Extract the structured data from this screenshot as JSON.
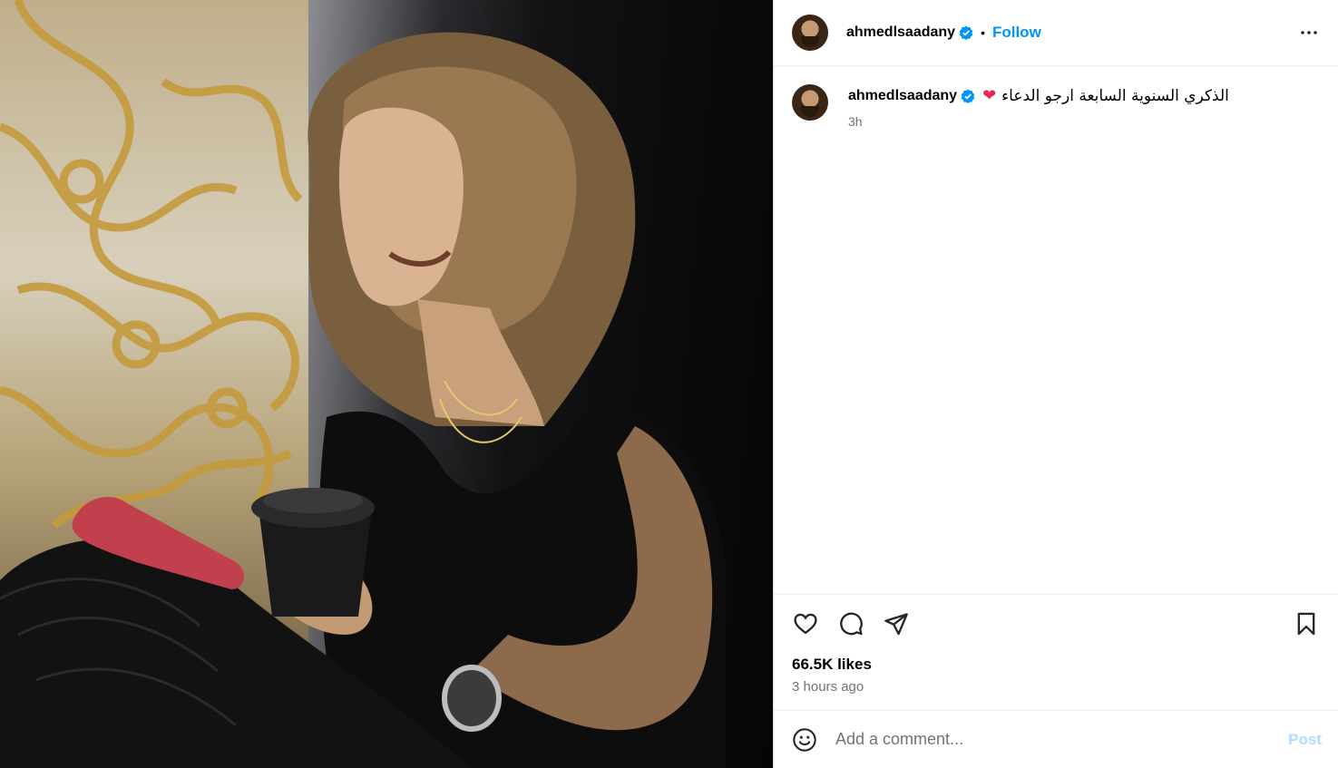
{
  "post": {
    "photo_alt": "Post photo",
    "author": "ahmedlsaadany",
    "follow_label": "Follow",
    "separator": "•",
    "caption_text": "الذكري السنوية السابعة ارجو الدعاء",
    "caption_emoji": "❤",
    "caption_time": "3h",
    "likes": "66.5K likes",
    "time_ago": "3 hours ago"
  },
  "comment": {
    "placeholder": "Add a comment...",
    "post_label": "Post"
  },
  "icons": {
    "more": "more-options-icon",
    "verified": "verified-badge-icon",
    "like": "heart-icon",
    "comment": "comment-icon",
    "share": "share-icon",
    "save": "bookmark-icon",
    "emoji": "emoji-icon"
  },
  "colors": {
    "follow": "#0095f6",
    "verified": "#0095f6",
    "post_disabled": "#b3dbff",
    "muted": "#737373",
    "heart_emoji": "#e8265a"
  }
}
